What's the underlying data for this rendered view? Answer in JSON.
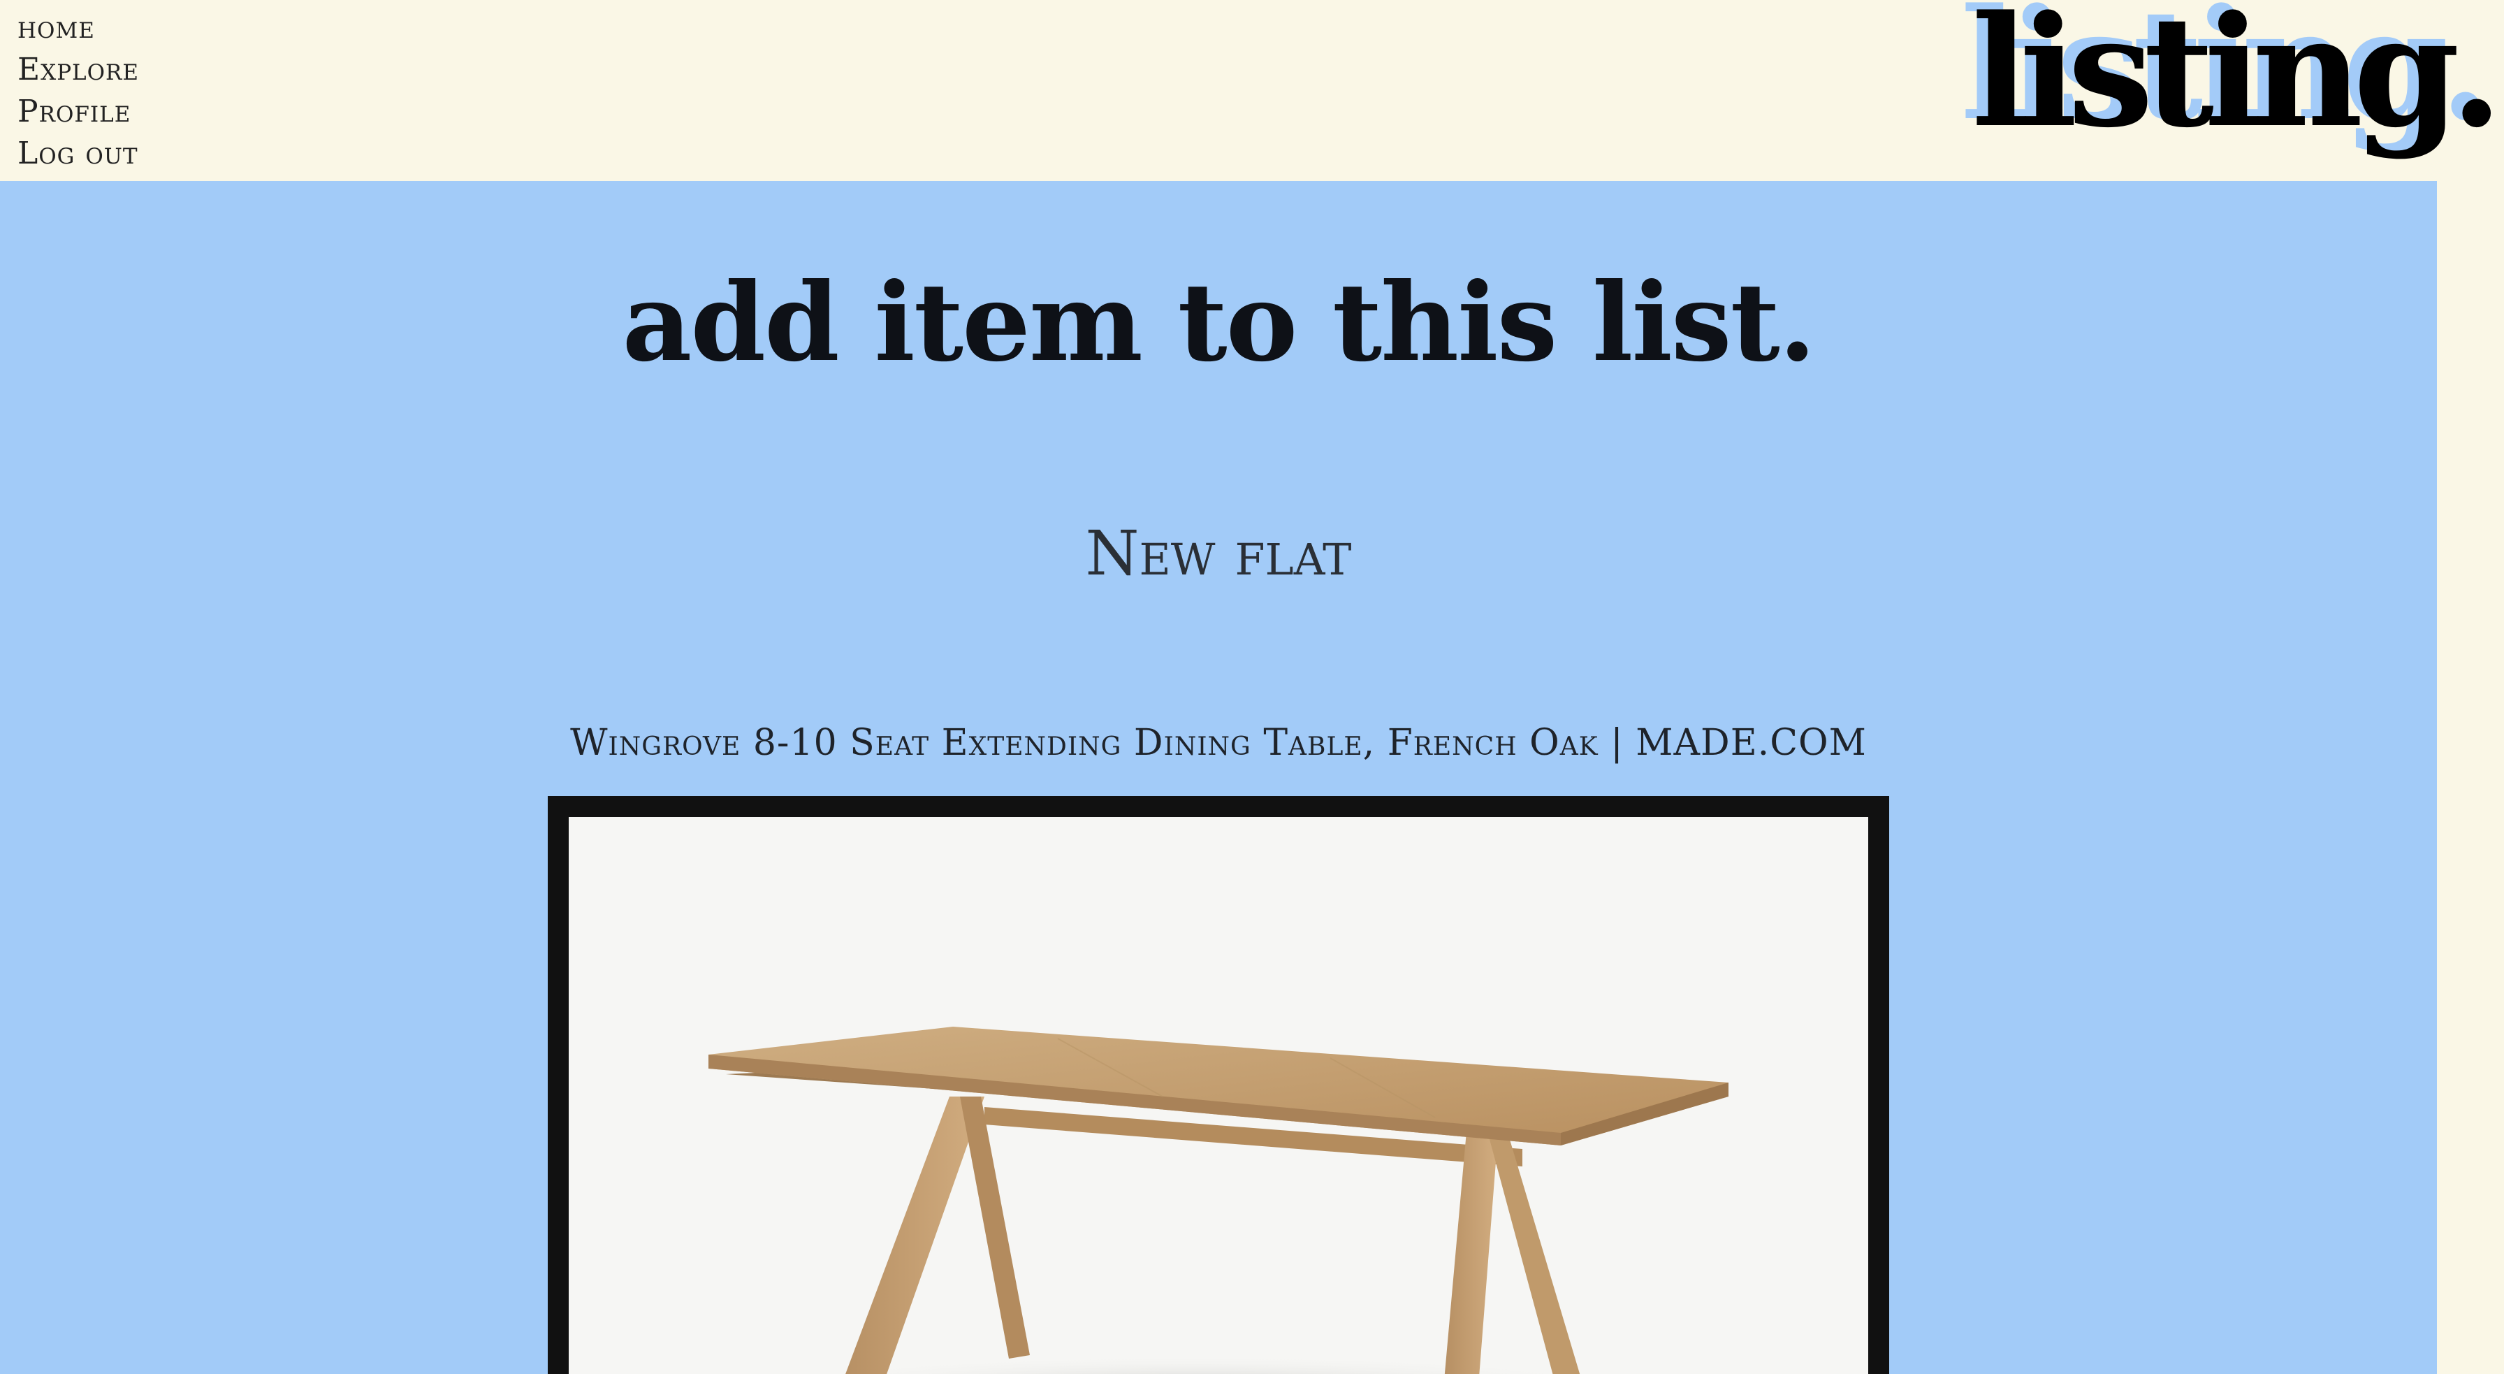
{
  "nav": {
    "home": "home",
    "explore": "Explore",
    "profile": "Profile",
    "logout": "Log out"
  },
  "logo": {
    "text": "listing."
  },
  "main": {
    "title": "add item to this list.",
    "list_name": "New flat",
    "item_title": "Wingrove 8-10 Seat Extending Dining Table, French Oak | MADE.COM"
  },
  "image": {
    "description": "product-photo-dining-table"
  },
  "colors": {
    "page_bg": "#faf7e6",
    "panel_bg": "#a2cbf8",
    "logo_shadow": "#a3cbf8",
    "frame": "#111111",
    "wood": "#c39d6e"
  }
}
